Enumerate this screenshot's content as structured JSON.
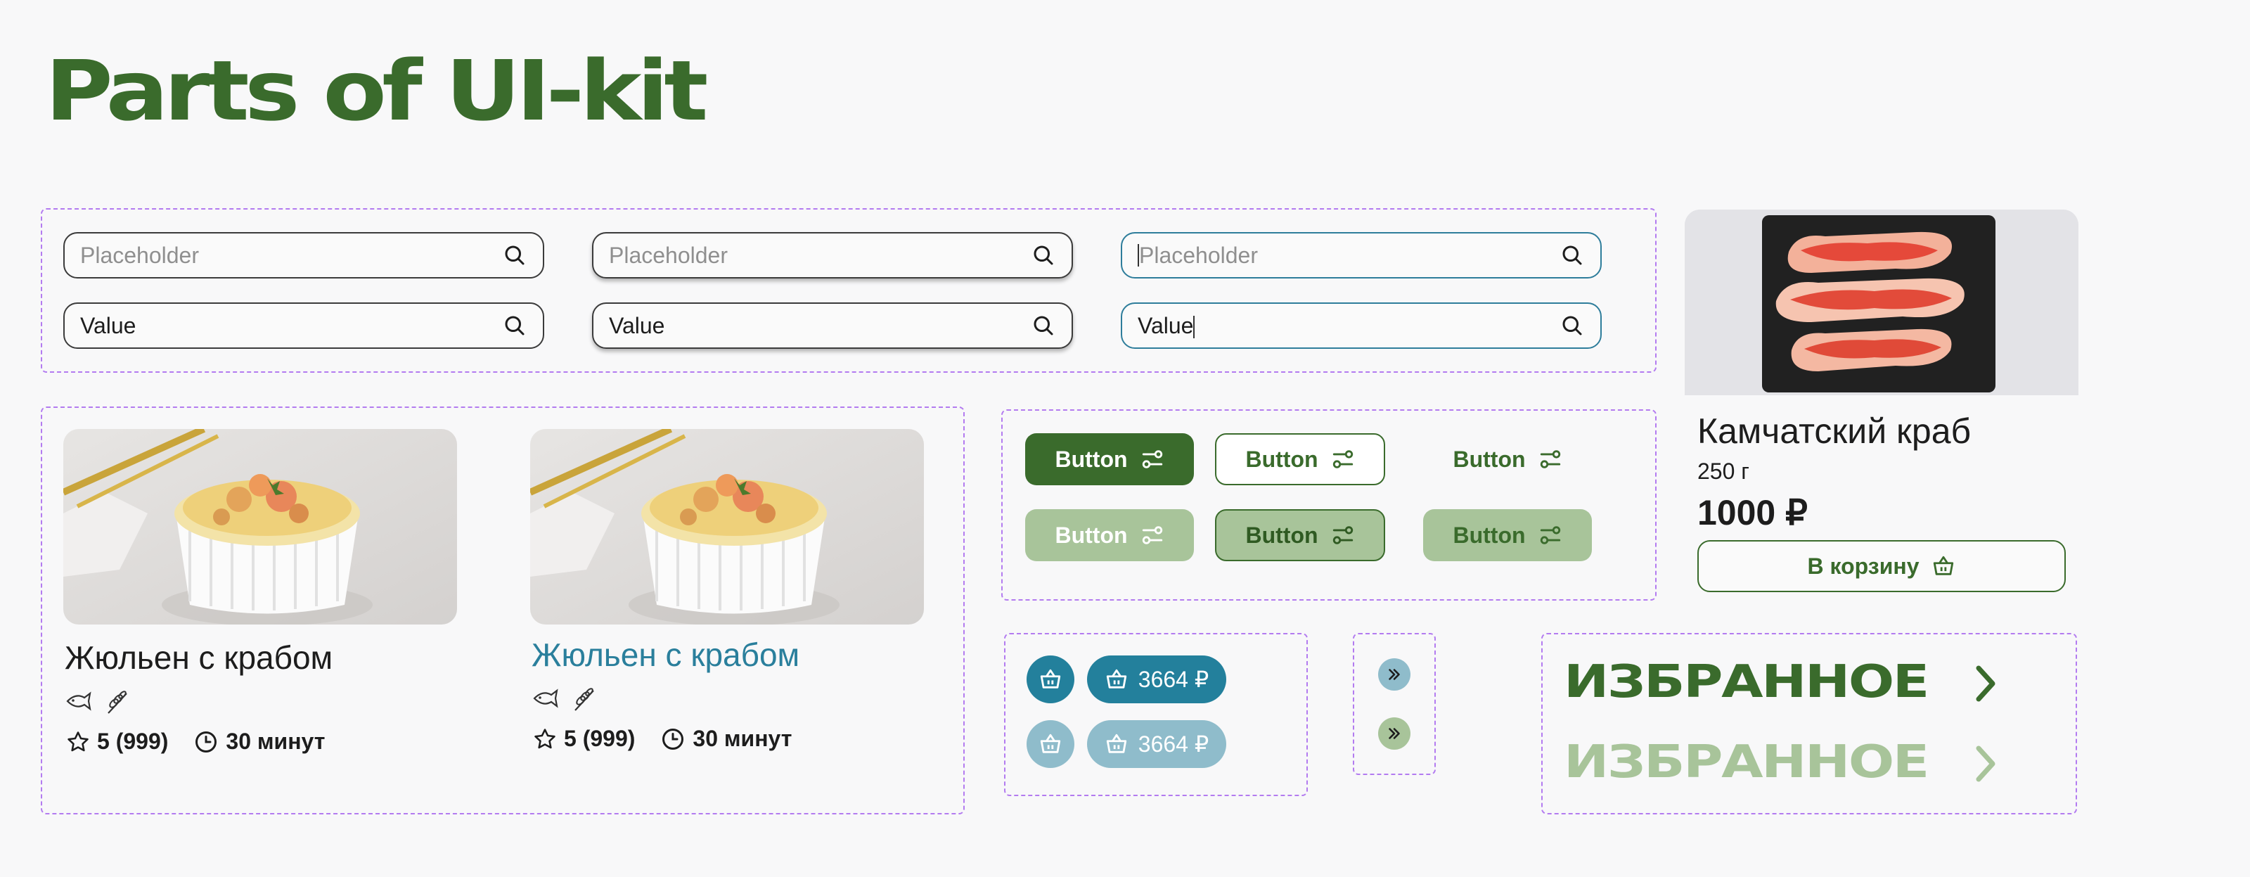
{
  "page": {
    "title": "Parts of UI-kit"
  },
  "search_fields": [
    {
      "text": "Placeholder",
      "kind": "placeholder",
      "variant": "default"
    },
    {
      "text": "Placeholder",
      "kind": "placeholder",
      "variant": "hover"
    },
    {
      "text": "Placeholder",
      "kind": "placeholder",
      "variant": "focus"
    },
    {
      "text": "Value",
      "kind": "value",
      "variant": "default"
    },
    {
      "text": "Value",
      "kind": "value",
      "variant": "hover"
    },
    {
      "text": "Value",
      "kind": "value",
      "variant": "focus"
    }
  ],
  "dish_cards": [
    {
      "title": "Жюльен с крабом",
      "rating": "5 (999)",
      "time": "30 минут",
      "title_color": "#1d1d1d"
    },
    {
      "title": "Жюльен с крабом",
      "rating": "5 (999)",
      "time": "30 минут",
      "title_color": "#2a7f9c"
    }
  ],
  "buttons": [
    {
      "label": "Button",
      "style": "filled"
    },
    {
      "label": "Button",
      "style": "outlined"
    },
    {
      "label": "Button",
      "style": "text"
    },
    {
      "label": "Button",
      "style": "filled-disabled"
    },
    {
      "label": "Button",
      "style": "pressed"
    },
    {
      "label": "Button",
      "style": "soft"
    }
  ],
  "cart_tags": {
    "price_active": "3664 ₽",
    "price_disabled": "3664 ₽"
  },
  "product": {
    "name": "Камчатский краб",
    "weight": "250 г",
    "price": "1000 ₽",
    "cart_button": "В корзину"
  },
  "favorites": {
    "active": "ИЗБРАННОЕ",
    "disabled": "ИЗБРАННОЕ"
  },
  "colors": {
    "green": "#3a6b2c",
    "green_light": "#a8c49a",
    "teal": "#23809c",
    "teal_light": "#8fbccb",
    "dashed": "#b37bf0"
  }
}
